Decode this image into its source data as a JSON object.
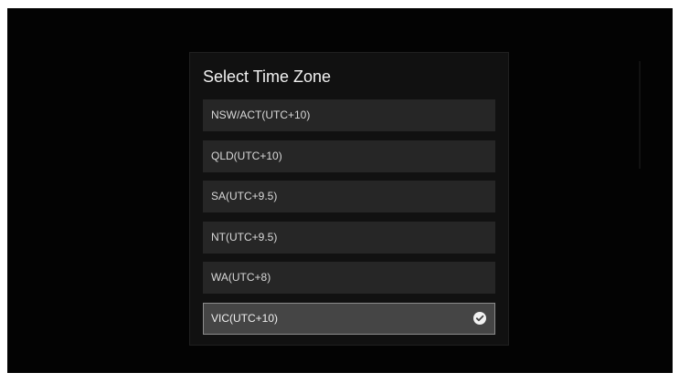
{
  "dialog": {
    "title": "Select Time Zone",
    "options": [
      {
        "label": "NSW/ACT(UTC+10)",
        "selected": false
      },
      {
        "label": "QLD(UTC+10)",
        "selected": false
      },
      {
        "label": "SA(UTC+9.5)",
        "selected": false
      },
      {
        "label": "NT(UTC+9.5)",
        "selected": false
      },
      {
        "label": "WA(UTC+8)",
        "selected": false
      },
      {
        "label": "VIC(UTC+10)",
        "selected": true,
        "icon": "check-circle-icon"
      }
    ]
  },
  "colors": {
    "screen_background": "#030303",
    "dialog_background": "#111111",
    "option_background": "#262626",
    "selected_background": "#454545",
    "selected_border": "#8c8c8c",
    "text": "#d9d9d9"
  }
}
